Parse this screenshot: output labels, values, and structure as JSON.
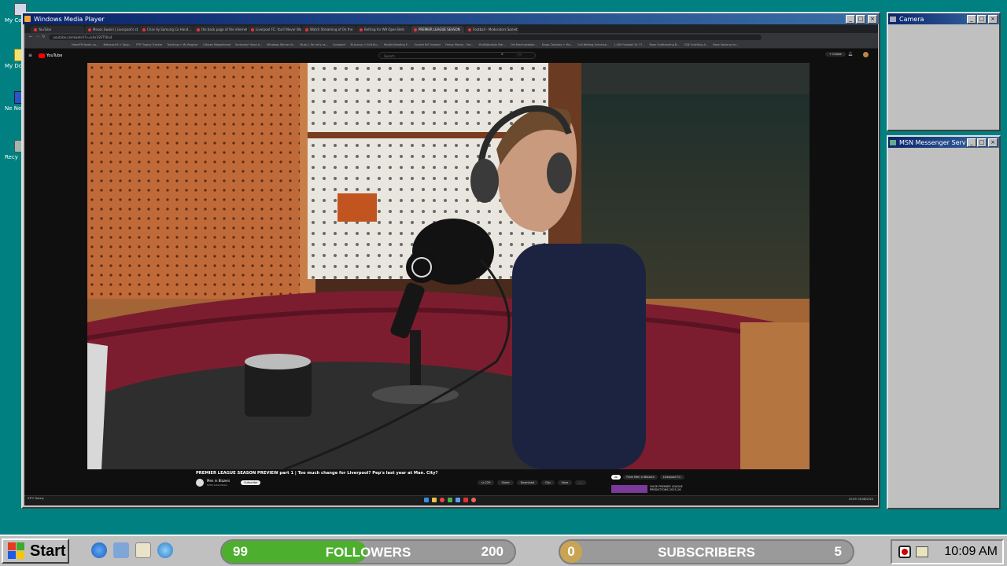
{
  "desktop": {
    "icons": [
      {
        "label": "My Co",
        "icon": "computer-icon"
      },
      {
        "label": "My Do",
        "icon": "documents-icon"
      },
      {
        "label": "Ne Neigh",
        "icon": "network-icon"
      },
      {
        "label": "Recy",
        "icon": "recycle-bin-icon"
      }
    ]
  },
  "media_player": {
    "title": "Windows Media Player",
    "buttons": [
      "_",
      "□",
      "×"
    ]
  },
  "camera_window": {
    "title": "Camera"
  },
  "msn_window": {
    "title": "MSN Messenger Service"
  },
  "browser": {
    "tabs": [
      {
        "label": "YouTube"
      },
      {
        "label": "Moses Swaini | Liverpool's st..."
      },
      {
        "label": "Chas Ay Samurig Co Hand..."
      },
      {
        "label": "the back page of the internet"
      },
      {
        "label": "Liverpool FC: You'll Never Walk"
      },
      {
        "label": "Watch Streaming of On the"
      },
      {
        "label": "Betting for W9 Open Bets"
      },
      {
        "label": "PREMIER LEAGUE SEASON"
      },
      {
        "label": "Football - Moderators Somet..."
      }
    ],
    "url": "youtube.com/watch?v=k4x1S9T5Kx4",
    "bookmarks": [
      "HeartFM beats nu...",
      "Betexact B > Topp...",
      "PTR Trophy Tracker",
      "Tracking > My Regular",
      "j Stores Megathread",
      "Screenes! Have a...",
      "Windows Winner N...",
      "Music | Far let's ca...",
      "Comptor!",
      "Bi-bunny > Edit Bu...",
      "Reddit Beading F...",
      "Scarlet IN7 Indexer",
      "Friday Money - Sec...",
      "MultiWordsAs Mar...",
      "Old Marchestable...",
      "Kings Carlocks + Ma...",
      "Cell Betting Universe...",
      "1.000 Football Sk 77...",
      "Rose Unattanding B...",
      "CDE Scottling A...",
      "Rose Vaulong Inc..."
    ],
    "youtube": {
      "logo_text": "YouTube",
      "search_placeholder": "Search",
      "create_label": "+ Create",
      "video_title": "PREMIER LEAGUE SEASON PREVIEW part 1 | Too much change for Liverpool? Pep's last year at Man. City?",
      "channel_name": "Men in Blazers",
      "channel_subs": "520K subscribers",
      "subscribe_label": "Subscribe",
      "likes": "229",
      "actions": [
        "Share",
        "Download",
        "Clip",
        "Save",
        "..."
      ],
      "chips": [
        "All",
        "From Men in Blazers",
        "Liverpool F.C."
      ],
      "rec_title": "HUGE PREMIER LEAGUE PREDICTIONS 2025-26"
    },
    "os_taskbar": {
      "weather": "23°C Sunny",
      "clock": "10:09 13/08/2025"
    }
  },
  "taskbar": {
    "start_label": "Start",
    "followers": {
      "current": "99",
      "label": "FOLLOWERS",
      "goal": "200",
      "progress": 0.495
    },
    "subscribers": {
      "current": "0",
      "label": "SUBSCRIBERS",
      "goal": "5",
      "progress": 0.0
    },
    "clock": "10:09 AM",
    "colors": {
      "followers_fill": "#4caf2e",
      "subscribers_fill": "#c9a452"
    }
  }
}
